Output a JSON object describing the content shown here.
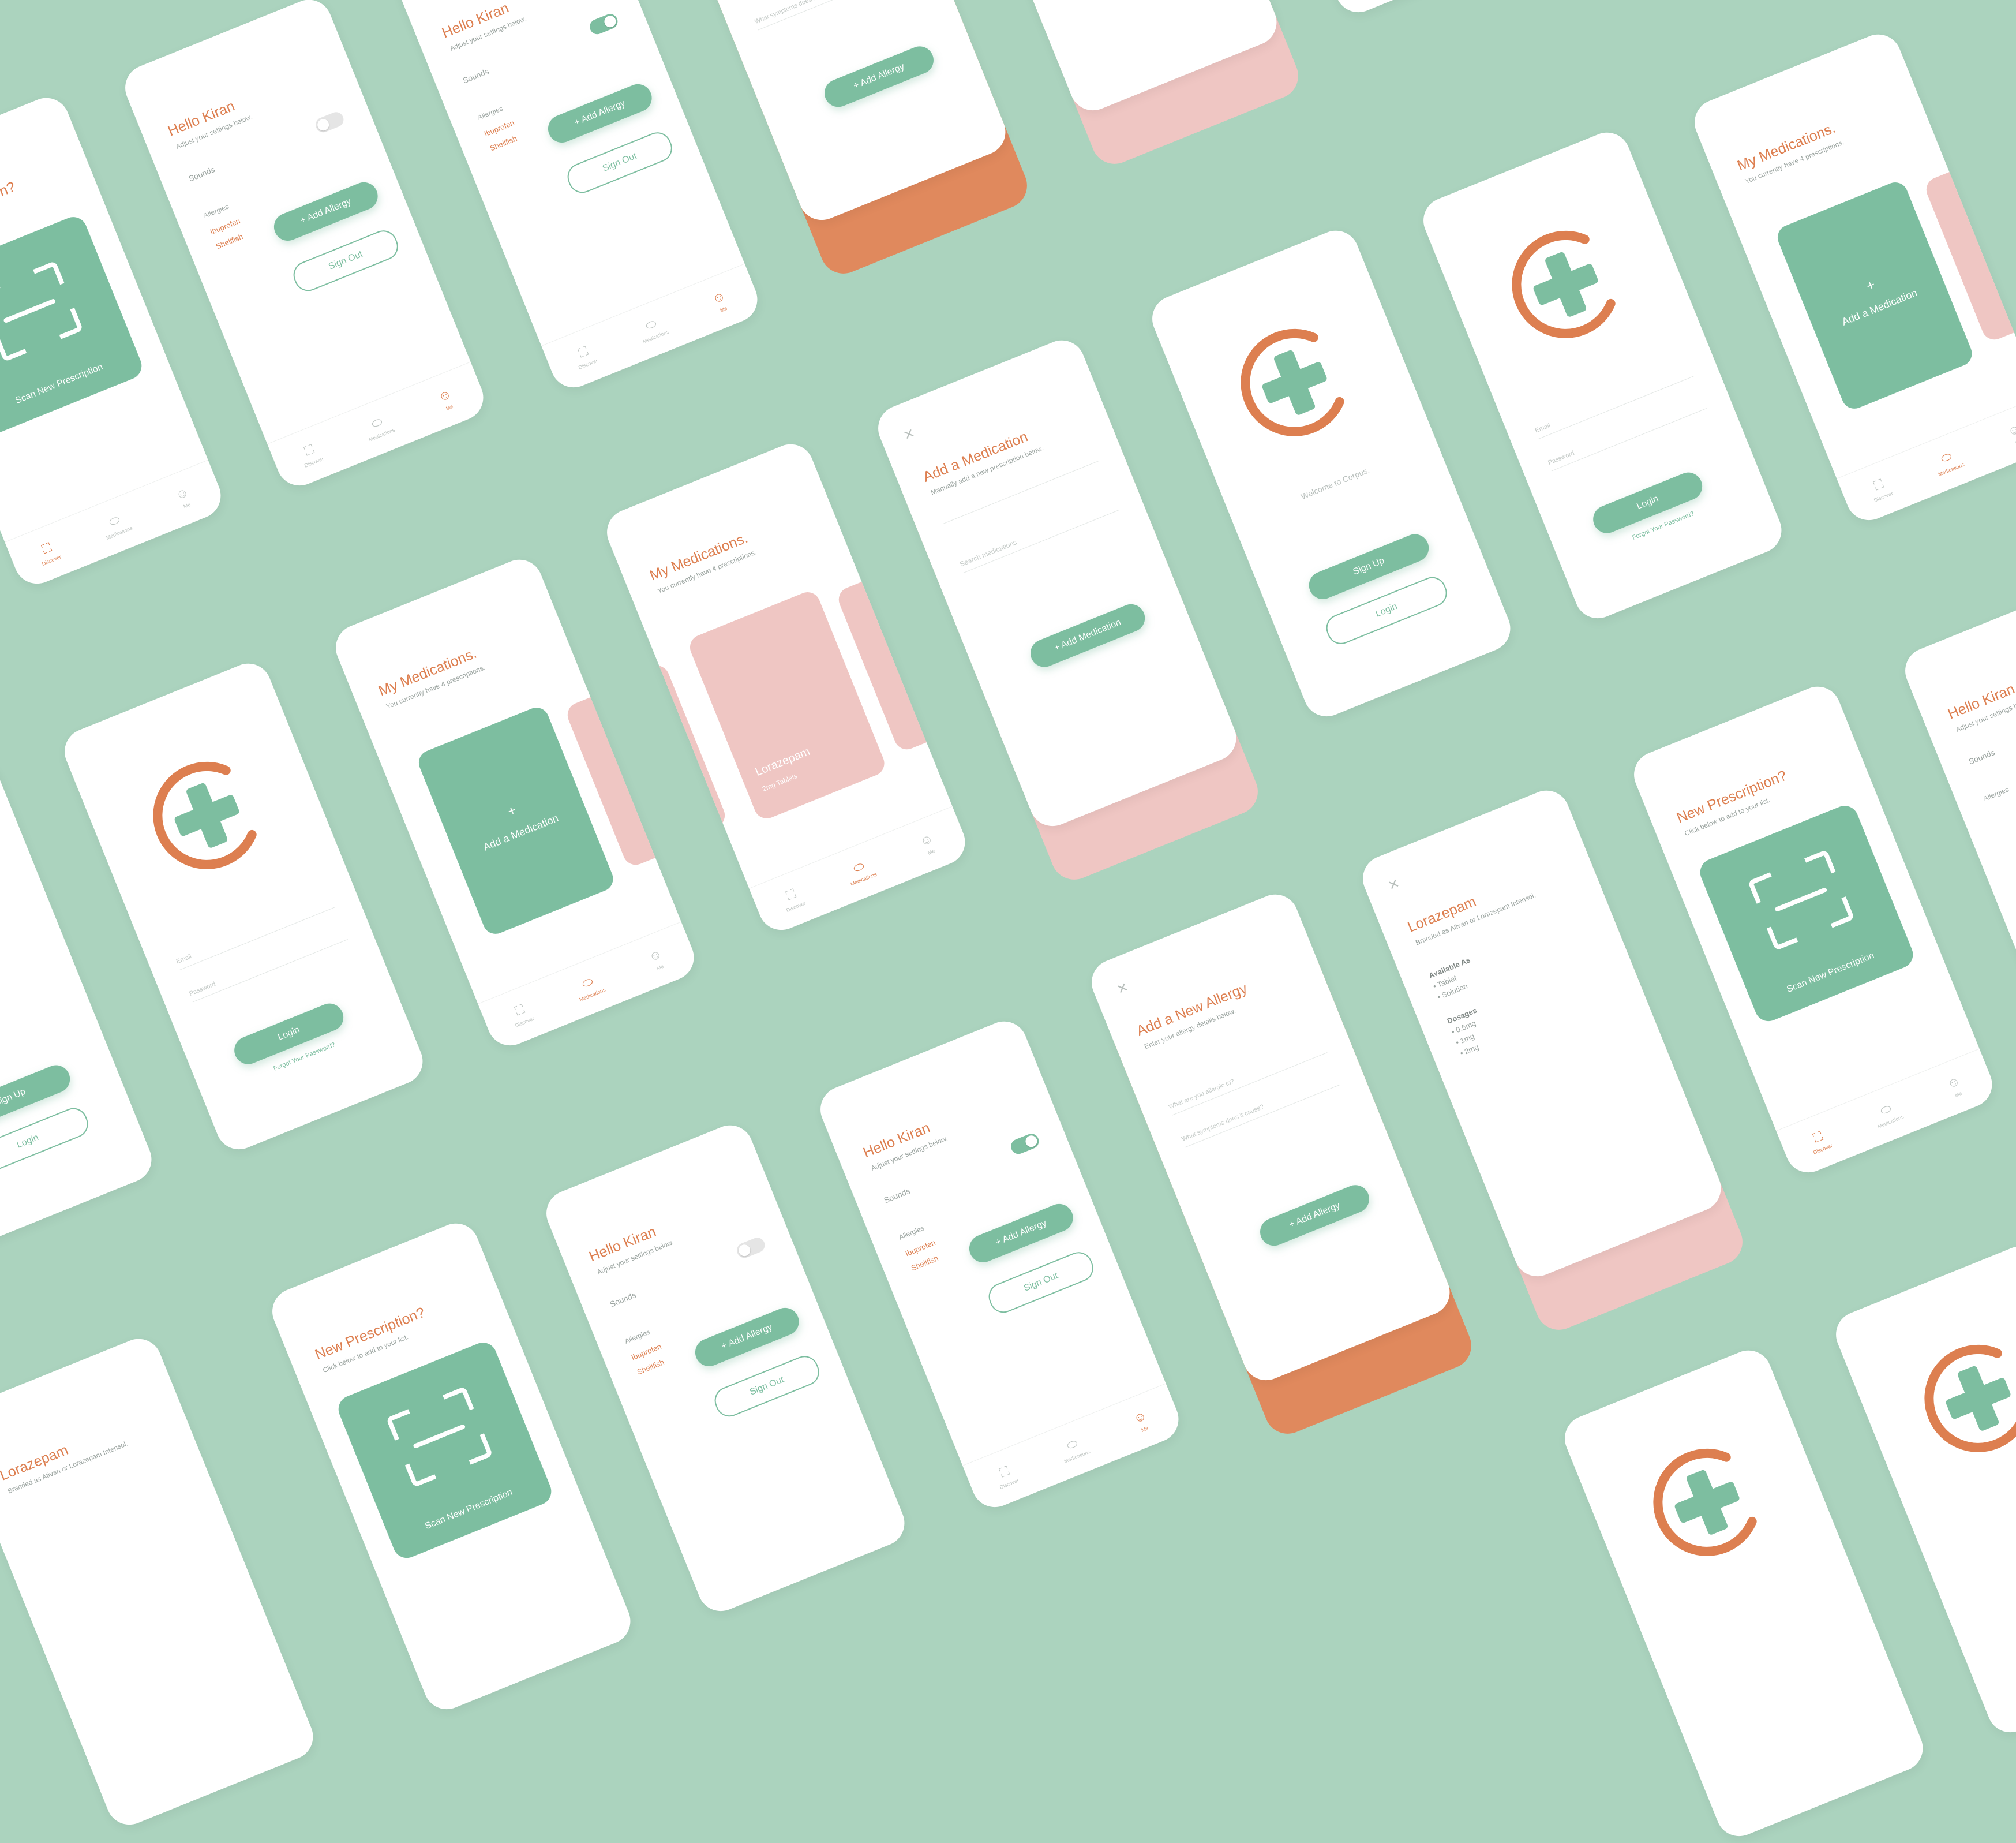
{
  "colors": {
    "background": "#abd3be",
    "accent": "#dd7f50",
    "green": "#7dbea0",
    "pink": "#efc6c3",
    "orange_under": "#e0895d"
  },
  "settings": {
    "greeting": "Hello Kiran",
    "subtitle": "Adjust your settings below.",
    "sounds_label": "Sounds",
    "allergies_label": "Allergies",
    "allergies": [
      "Ibuprofen",
      "Shellfish"
    ],
    "add_allergy_button": "+ Add Allergy",
    "sign_out_button": "Sign Out"
  },
  "nav": {
    "discover": "Discover",
    "medications": "Medications",
    "me": "Me",
    "discover_icon": "scan-icon",
    "medications_icon": "pill-icon",
    "me_icon": "smiley-icon"
  },
  "medications": {
    "title": "My Medications.",
    "subtitle": "You currently have 4 prescriptions.",
    "add_card_plus": "+",
    "add_card_label": "Add a Medication",
    "med_name": "Lorazepam",
    "med_dose": "2mg Tablets"
  },
  "add_medication": {
    "close_glyph": "×",
    "title": "Add a Medication",
    "subtitle": "Manually add a new prescription below.",
    "search_placeholder": "Search medications",
    "button": "+ Add Medication"
  },
  "add_allergy": {
    "close_glyph": "×",
    "title": "Add a New Allergy",
    "subtitle": "Enter your allergy details below.",
    "field1_placeholder": "What are you allergic to?",
    "field2_placeholder": "What symptoms does it cause?",
    "button": "+ Add Allergy"
  },
  "welcome": {
    "text": "Welcome to Corpus.",
    "sign_up_button": "Sign Up",
    "login_button": "Login"
  },
  "login": {
    "email_placeholder": "Email",
    "password_placeholder": "Password",
    "login_button": "Login",
    "forgot": "Forgot Your Password?"
  },
  "scan": {
    "title": "New Prescription?",
    "subtitle": "Click below to add to your list.",
    "button_label": "Scan New Prescription"
  },
  "detail": {
    "close_glyph": "×",
    "name": "Lorazepam",
    "branded": "Branded as Ativan or Lorazepam Intensol.",
    "available_heading": "Available As",
    "available": "• Tablet\n• Solution",
    "dosages_heading": "Dosages",
    "dosages": "• 0.5mg\n• 1mg\n• 2mg"
  }
}
